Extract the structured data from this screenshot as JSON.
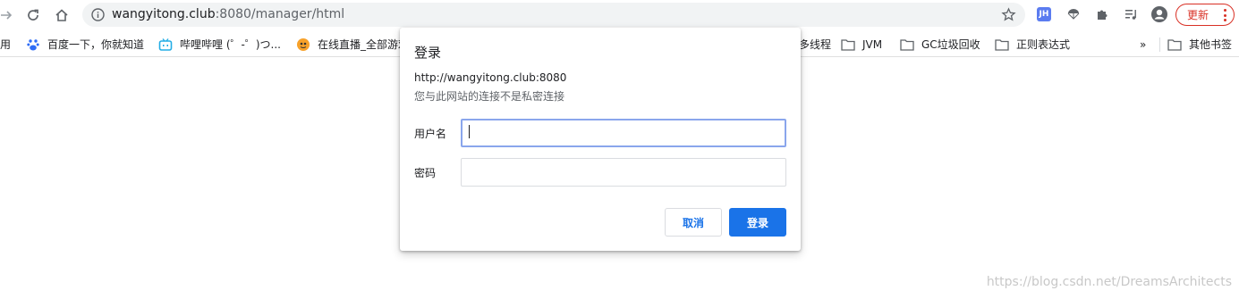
{
  "browser": {
    "url_host": "wangyitong.club",
    "url_rest": ":8080/manager/html",
    "update_label": "更新"
  },
  "bookmarks": {
    "items": [
      {
        "label": "用"
      },
      {
        "label": "百度一下，你就知道"
      },
      {
        "label": "哔哩哔哩 (゜-゜)つ..."
      },
      {
        "label": "在线直播_全部游戏"
      },
      {
        "label": "多线程"
      },
      {
        "label": "JVM"
      },
      {
        "label": "GC垃圾回收"
      },
      {
        "label": "正则表达式"
      }
    ],
    "overflow": "»",
    "other_label": "其他书签"
  },
  "dialog": {
    "title": "登录",
    "origin": "http://wangyitong.club:8080",
    "note": "您与此网站的连接不是私密连接",
    "username_label": "用户名",
    "password_label": "密码",
    "username_value": "",
    "password_value": "",
    "cancel_label": "取消",
    "login_label": "登录"
  },
  "watermark": "https://blog.csdn.net/DreamsArchitects",
  "colors": {
    "accent": "#1a73e8",
    "update": "#d93025"
  }
}
